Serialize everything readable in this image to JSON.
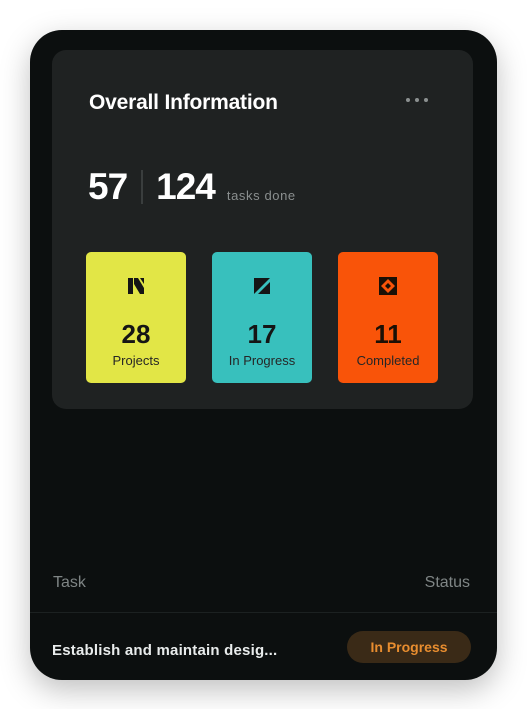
{
  "card": {
    "title": "Overall Information",
    "more_icon": "more-horizontal-icon",
    "tasks_done_count": "57",
    "tasks_total": "124",
    "tasks_done_label": "tasks done"
  },
  "tiles": [
    {
      "icon": "projects-icon",
      "value": "28",
      "label": "Projects",
      "color": "#e2e646"
    },
    {
      "icon": "in-progress-icon",
      "value": "17",
      "label": "In Progress",
      "color": "#38c0bd"
    },
    {
      "icon": "completed-icon",
      "value": "11",
      "label": "Completed",
      "color": "#f95409"
    }
  ],
  "table": {
    "headers": {
      "task": "Task",
      "status": "Status"
    },
    "rows": [
      {
        "task": "Establish and maintain desig...",
        "status": "In Progress",
        "status_color": "#e88d2f"
      }
    ]
  }
}
